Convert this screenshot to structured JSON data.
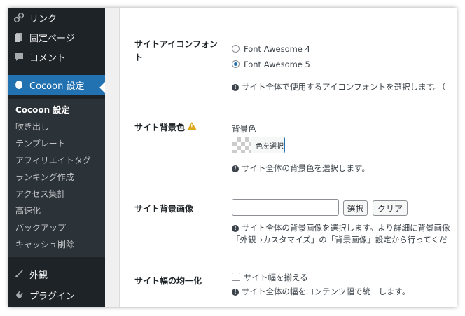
{
  "sidebar": {
    "items": [
      {
        "label": "リンク",
        "icon": "link-icon"
      },
      {
        "label": "固定ページ",
        "icon": "page-icon"
      },
      {
        "label": "コメント",
        "icon": "comment-icon"
      },
      {
        "label": "Cocoon 設定",
        "icon": "cocoon-icon"
      },
      {
        "label": "外観",
        "icon": "appearance-icon"
      },
      {
        "label": "プラグイン",
        "icon": "plugin-icon"
      }
    ],
    "submenu": [
      "Cocoon 設定",
      "吹き出し",
      "テンプレート",
      "アフィリエイトタグ",
      "ランキング作成",
      "アクセス集計",
      "高速化",
      "バックアップ",
      "キャッシュ削除"
    ]
  },
  "settings": {
    "icon_font": {
      "label_line1": "サイトアイコンフォン",
      "label_line2": "ト",
      "options": [
        "Font Awesome 4",
        "Font Awesome 5"
      ],
      "selected": "Font Awesome 5",
      "help": "サイト全体で使用するアイコンフォントを選択します。（"
    },
    "bg_color": {
      "label": "サイト背景色",
      "sublabel": "背景色",
      "button": "色を選択",
      "help": "サイト全体の背景色を選択します。"
    },
    "bg_image": {
      "label": "サイト背景画像",
      "select_button": "選択",
      "clear_button": "クリア",
      "help_line1": "サイト全体の背景画像を選択します。より詳細に背景画像",
      "help_line2": "「外観→カスタマイズ」の「背景画像」設定から行ってくだ"
    },
    "width": {
      "label": "サイト幅の均一化",
      "checkbox": "サイト幅を揃える",
      "help": "サイト全体の幅をコンテンツ幅で統一します。"
    }
  },
  "colors": {
    "sidebar": "#1d2327",
    "submenu": "#2c3338",
    "accent": "#2271b1",
    "warning": "#dba617"
  }
}
